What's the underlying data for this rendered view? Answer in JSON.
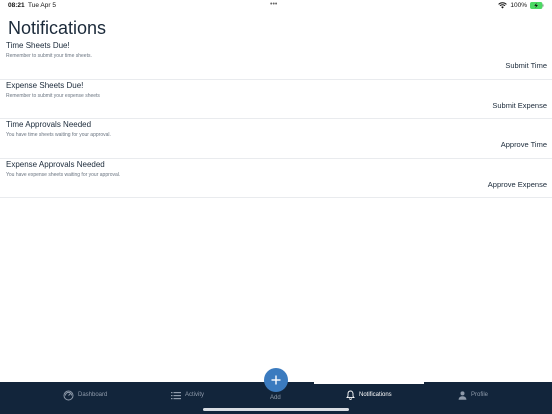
{
  "status_bar": {
    "time": "08:21",
    "date": "Tue Apr 5",
    "battery": "100%"
  },
  "header": {
    "title": "Notifications"
  },
  "notifications": [
    {
      "title": "Time Sheets Due!",
      "subtitle": "Remember to submit your time sheets.",
      "action": "Submit Time"
    },
    {
      "title": "Expense Sheets Due!",
      "subtitle": "Remember to submit your expense sheets",
      "action": "Submit Expense"
    },
    {
      "title": "Time Approvals Needed",
      "subtitle": "You have time sheets waiting for your approval.",
      "action": "Approve Time"
    },
    {
      "title": "Expense Approvals Needed",
      "subtitle": "You have expense sheets waiting for your approval.",
      "action": "Approve Expense"
    }
  ],
  "tab_bar": {
    "tabs": [
      {
        "label": "Dashboard",
        "icon": "dashboard-icon"
      },
      {
        "label": "Activity",
        "icon": "list-icon"
      },
      {
        "label": "Add",
        "icon": "plus-icon"
      },
      {
        "label": "Notifications",
        "icon": "bell-icon",
        "active": true
      },
      {
        "label": "Profile",
        "icon": "person-icon"
      }
    ]
  },
  "colors": {
    "tab_bar_bg": "#12253b",
    "accent": "#3b7bbf",
    "text": "#1b2a3a"
  }
}
